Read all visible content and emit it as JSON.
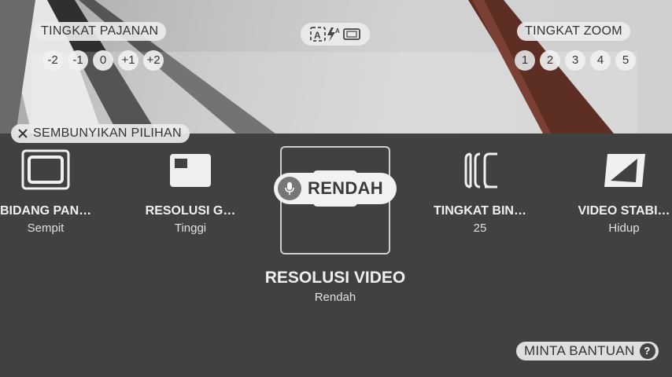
{
  "exposure": {
    "title": "TINGKAT PAJANAN",
    "options": [
      "-2",
      "-1",
      "0",
      "+1",
      "+2"
    ]
  },
  "zoom": {
    "title": "TINGKAT ZOOM",
    "options": [
      "1",
      "2",
      "3",
      "4",
      "5"
    ]
  },
  "hide_options": {
    "label": "SEMBUNYIKAN PILIHAN"
  },
  "settings": [
    {
      "title": "BIDANG PAN…",
      "value": "Sempit",
      "icon": "framing-icon"
    },
    {
      "title": "RESOLUSI G…",
      "value": "Tinggi",
      "icon": "photo-resolution-icon"
    },
    {
      "title": "RESOLUSI VIDEO",
      "value": "Rendah",
      "icon": "video-resolution-icon"
    },
    {
      "title": "TINGKAT BIN…",
      "value": "25",
      "icon": "frame-rate-icon"
    },
    {
      "title": "VIDEO STABI…",
      "value": "Hidup",
      "icon": "stabilization-icon"
    }
  ],
  "voice_chip": {
    "label": "RENDAH",
    "icon": "microphone-icon"
  },
  "help": {
    "label": "MINTA BANTUAN",
    "icon": "help-icon"
  },
  "colors": {
    "panel": "#414141",
    "pill": "#ebebeb",
    "accent_text": "#333333"
  }
}
